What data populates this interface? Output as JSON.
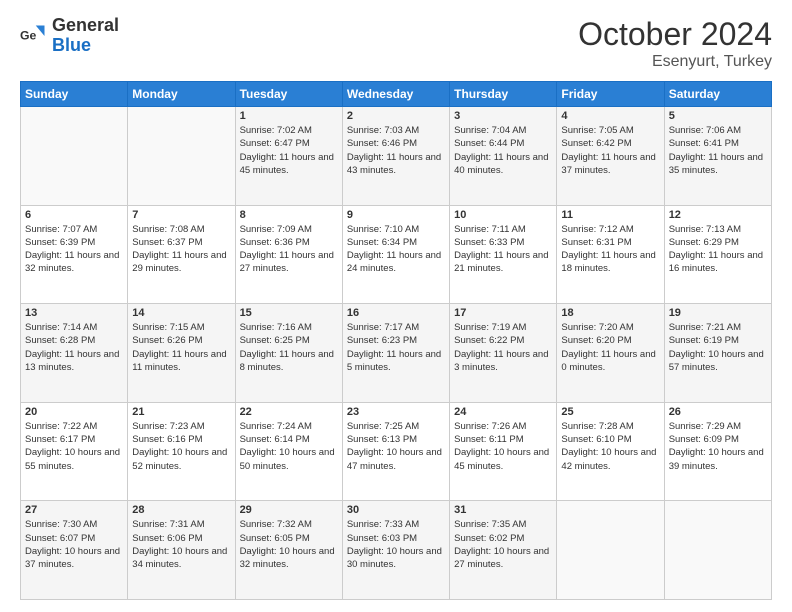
{
  "logo": {
    "general": "General",
    "blue": "Blue"
  },
  "header": {
    "month": "October 2024",
    "location": "Esenyurt, Turkey"
  },
  "weekdays": [
    "Sunday",
    "Monday",
    "Tuesday",
    "Wednesday",
    "Thursday",
    "Friday",
    "Saturday"
  ],
  "weeks": [
    [
      {
        "day": "",
        "sunrise": "",
        "sunset": "",
        "daylight": ""
      },
      {
        "day": "",
        "sunrise": "",
        "sunset": "",
        "daylight": ""
      },
      {
        "day": "1",
        "sunrise": "Sunrise: 7:02 AM",
        "sunset": "Sunset: 6:47 PM",
        "daylight": "Daylight: 11 hours and 45 minutes."
      },
      {
        "day": "2",
        "sunrise": "Sunrise: 7:03 AM",
        "sunset": "Sunset: 6:46 PM",
        "daylight": "Daylight: 11 hours and 43 minutes."
      },
      {
        "day": "3",
        "sunrise": "Sunrise: 7:04 AM",
        "sunset": "Sunset: 6:44 PM",
        "daylight": "Daylight: 11 hours and 40 minutes."
      },
      {
        "day": "4",
        "sunrise": "Sunrise: 7:05 AM",
        "sunset": "Sunset: 6:42 PM",
        "daylight": "Daylight: 11 hours and 37 minutes."
      },
      {
        "day": "5",
        "sunrise": "Sunrise: 7:06 AM",
        "sunset": "Sunset: 6:41 PM",
        "daylight": "Daylight: 11 hours and 35 minutes."
      }
    ],
    [
      {
        "day": "6",
        "sunrise": "Sunrise: 7:07 AM",
        "sunset": "Sunset: 6:39 PM",
        "daylight": "Daylight: 11 hours and 32 minutes."
      },
      {
        "day": "7",
        "sunrise": "Sunrise: 7:08 AM",
        "sunset": "Sunset: 6:37 PM",
        "daylight": "Daylight: 11 hours and 29 minutes."
      },
      {
        "day": "8",
        "sunrise": "Sunrise: 7:09 AM",
        "sunset": "Sunset: 6:36 PM",
        "daylight": "Daylight: 11 hours and 27 minutes."
      },
      {
        "day": "9",
        "sunrise": "Sunrise: 7:10 AM",
        "sunset": "Sunset: 6:34 PM",
        "daylight": "Daylight: 11 hours and 24 minutes."
      },
      {
        "day": "10",
        "sunrise": "Sunrise: 7:11 AM",
        "sunset": "Sunset: 6:33 PM",
        "daylight": "Daylight: 11 hours and 21 minutes."
      },
      {
        "day": "11",
        "sunrise": "Sunrise: 7:12 AM",
        "sunset": "Sunset: 6:31 PM",
        "daylight": "Daylight: 11 hours and 18 minutes."
      },
      {
        "day": "12",
        "sunrise": "Sunrise: 7:13 AM",
        "sunset": "Sunset: 6:29 PM",
        "daylight": "Daylight: 11 hours and 16 minutes."
      }
    ],
    [
      {
        "day": "13",
        "sunrise": "Sunrise: 7:14 AM",
        "sunset": "Sunset: 6:28 PM",
        "daylight": "Daylight: 11 hours and 13 minutes."
      },
      {
        "day": "14",
        "sunrise": "Sunrise: 7:15 AM",
        "sunset": "Sunset: 6:26 PM",
        "daylight": "Daylight: 11 hours and 11 minutes."
      },
      {
        "day": "15",
        "sunrise": "Sunrise: 7:16 AM",
        "sunset": "Sunset: 6:25 PM",
        "daylight": "Daylight: 11 hours and 8 minutes."
      },
      {
        "day": "16",
        "sunrise": "Sunrise: 7:17 AM",
        "sunset": "Sunset: 6:23 PM",
        "daylight": "Daylight: 11 hours and 5 minutes."
      },
      {
        "day": "17",
        "sunrise": "Sunrise: 7:19 AM",
        "sunset": "Sunset: 6:22 PM",
        "daylight": "Daylight: 11 hours and 3 minutes."
      },
      {
        "day": "18",
        "sunrise": "Sunrise: 7:20 AM",
        "sunset": "Sunset: 6:20 PM",
        "daylight": "Daylight: 11 hours and 0 minutes."
      },
      {
        "day": "19",
        "sunrise": "Sunrise: 7:21 AM",
        "sunset": "Sunset: 6:19 PM",
        "daylight": "Daylight: 10 hours and 57 minutes."
      }
    ],
    [
      {
        "day": "20",
        "sunrise": "Sunrise: 7:22 AM",
        "sunset": "Sunset: 6:17 PM",
        "daylight": "Daylight: 10 hours and 55 minutes."
      },
      {
        "day": "21",
        "sunrise": "Sunrise: 7:23 AM",
        "sunset": "Sunset: 6:16 PM",
        "daylight": "Daylight: 10 hours and 52 minutes."
      },
      {
        "day": "22",
        "sunrise": "Sunrise: 7:24 AM",
        "sunset": "Sunset: 6:14 PM",
        "daylight": "Daylight: 10 hours and 50 minutes."
      },
      {
        "day": "23",
        "sunrise": "Sunrise: 7:25 AM",
        "sunset": "Sunset: 6:13 PM",
        "daylight": "Daylight: 10 hours and 47 minutes."
      },
      {
        "day": "24",
        "sunrise": "Sunrise: 7:26 AM",
        "sunset": "Sunset: 6:11 PM",
        "daylight": "Daylight: 10 hours and 45 minutes."
      },
      {
        "day": "25",
        "sunrise": "Sunrise: 7:28 AM",
        "sunset": "Sunset: 6:10 PM",
        "daylight": "Daylight: 10 hours and 42 minutes."
      },
      {
        "day": "26",
        "sunrise": "Sunrise: 7:29 AM",
        "sunset": "Sunset: 6:09 PM",
        "daylight": "Daylight: 10 hours and 39 minutes."
      }
    ],
    [
      {
        "day": "27",
        "sunrise": "Sunrise: 7:30 AM",
        "sunset": "Sunset: 6:07 PM",
        "daylight": "Daylight: 10 hours and 37 minutes."
      },
      {
        "day": "28",
        "sunrise": "Sunrise: 7:31 AM",
        "sunset": "Sunset: 6:06 PM",
        "daylight": "Daylight: 10 hours and 34 minutes."
      },
      {
        "day": "29",
        "sunrise": "Sunrise: 7:32 AM",
        "sunset": "Sunset: 6:05 PM",
        "daylight": "Daylight: 10 hours and 32 minutes."
      },
      {
        "day": "30",
        "sunrise": "Sunrise: 7:33 AM",
        "sunset": "Sunset: 6:03 PM",
        "daylight": "Daylight: 10 hours and 30 minutes."
      },
      {
        "day": "31",
        "sunrise": "Sunrise: 7:35 AM",
        "sunset": "Sunset: 6:02 PM",
        "daylight": "Daylight: 10 hours and 27 minutes."
      },
      {
        "day": "",
        "sunrise": "",
        "sunset": "",
        "daylight": ""
      },
      {
        "day": "",
        "sunrise": "",
        "sunset": "",
        "daylight": ""
      }
    ]
  ]
}
